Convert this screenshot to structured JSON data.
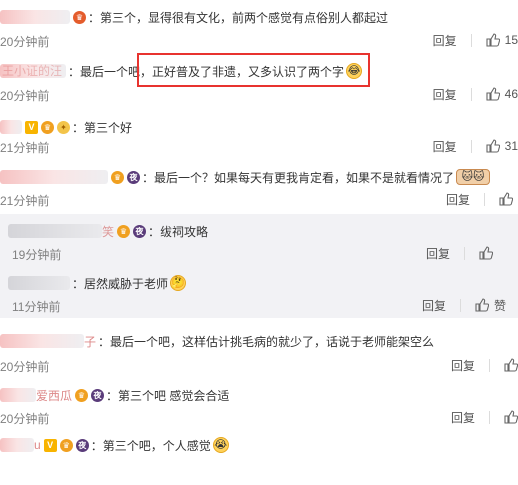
{
  "ui": {
    "reply_label": "回复",
    "like_label": "赞"
  },
  "comments": [
    {
      "text": "第三个，显得很有文化，前两个感觉有点俗别人都起过",
      "time": "20分钟前",
      "likes": "15",
      "emoji": ""
    },
    {
      "text": "最后一个吧，正好普及了非遗，又多认识了两个字",
      "time": "20分钟前",
      "likes": "46",
      "emoji": "😂"
    },
    {
      "text": "第三个好",
      "time": "21分钟前",
      "likes": "31",
      "emoji": ""
    },
    {
      "text": "最后一个？如果每天有更我肯定看，如果不是就看情况了",
      "time": "21分钟前",
      "likes": "",
      "emoji": "🐱🐱"
    },
    {
      "text": "绂祠攻略",
      "time": "19分钟前",
      "likes": "",
      "emoji": ""
    },
    {
      "text": "居然威胁于老师",
      "time": "11分钟前",
      "likes": "",
      "emoji": "🤔"
    },
    {
      "text": "最后一个吧，这样估计挑毛病的就少了，话说于老师能架空么",
      "time": "20分钟前",
      "likes": "",
      "emoji": ""
    },
    {
      "text": "第三个吧 感觉会合适",
      "time": "20分钟前",
      "likes": "",
      "emoji": ""
    },
    {
      "text": "第三个吧，个人感觉",
      "time": "",
      "likes": "",
      "emoji": "😭"
    }
  ],
  "visible_name_fragments": {
    "c2": "王小证的汪",
    "c5": "笑",
    "c7": "子",
    "c8": "爱西瓜",
    "c9": "u"
  },
  "colors": {
    "highlight_border": "#e8332f",
    "reply_bg": "#f2f2f5",
    "time": "#808080"
  }
}
